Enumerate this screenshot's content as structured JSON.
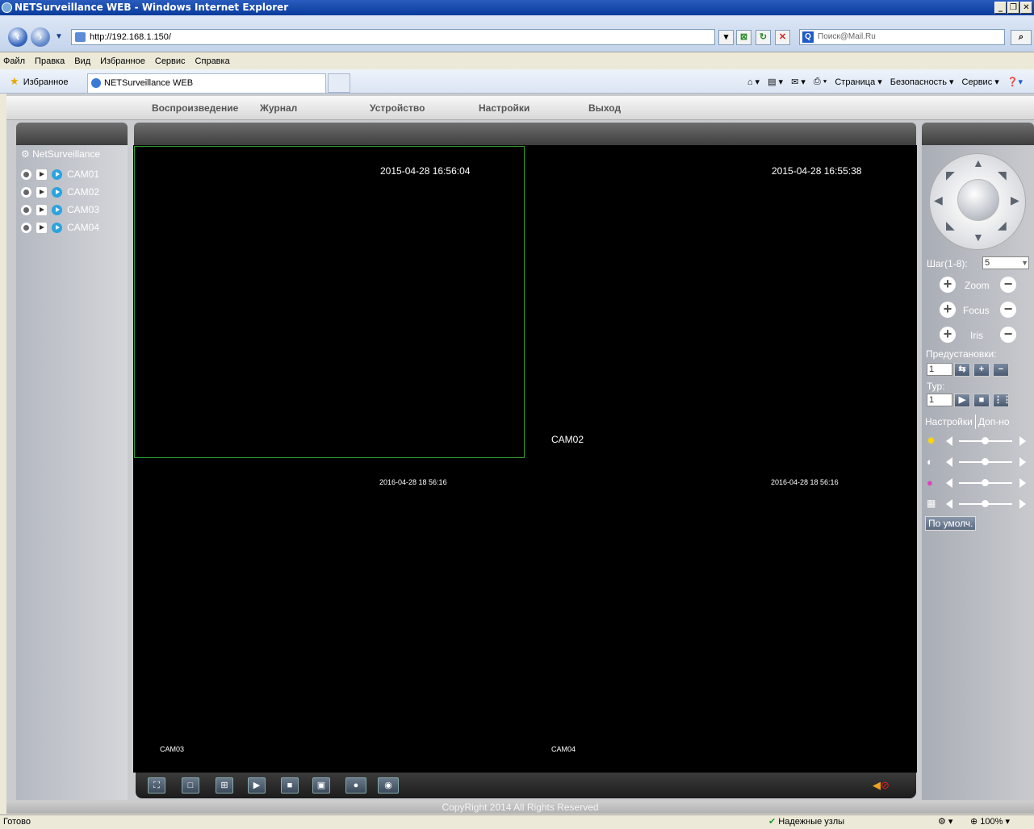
{
  "window": {
    "title": "NETSurveillance WEB - Windows Internet Explorer",
    "buttons": [
      "_",
      "❒",
      "✕"
    ]
  },
  "browser": {
    "url": "http://192.168.1.150/",
    "search_placeholder": "Поиск@Mail.Ru",
    "menu": [
      "Файл",
      "Правка",
      "Вид",
      "Избранное",
      "Сервис",
      "Справка"
    ],
    "favorites_label": "Избранное",
    "tab_title": "NETSurveillance WEB",
    "command_bar": [
      "Страница ▾",
      "Безопасность ▾",
      "Сервис ▾"
    ]
  },
  "app": {
    "nav": [
      "Воспроизведение",
      "Журнал",
      "Устройство",
      "Настройки",
      "Выход"
    ],
    "device_tree": {
      "root": "NetSurveillance",
      "cameras": [
        "CAM01",
        "CAM02",
        "CAM03",
        "CAM04"
      ]
    },
    "video": {
      "cells": [
        {
          "timestamp": "2015-04-28 16:56:04",
          "label": ""
        },
        {
          "timestamp": "2015-04-28 16:55:38",
          "label": "CAM02"
        },
        {
          "timestamp": "2016-04-28 18 56:16",
          "label": "CAM03"
        },
        {
          "timestamp": "2016-04-28 18 56:16",
          "label": "CAM04"
        }
      ]
    },
    "ptz": {
      "step_label": "Шаг(1-8):",
      "step_value": "5",
      "zoom_label": "Zoom",
      "focus_label": "Focus",
      "iris_label": "Iris",
      "presets_label": "Предустановки:",
      "preset_value": "1",
      "tour_label": "Тур:",
      "tour_value": "1"
    },
    "settings_tabs": [
      "Настройки",
      "Доп-но"
    ],
    "default_button": "По умолч.",
    "copyright": "CopyRight 2014 All Rights Reserved"
  },
  "status": {
    "left": "Готово",
    "zone": "Надежные узлы",
    "zoom": "100%"
  }
}
